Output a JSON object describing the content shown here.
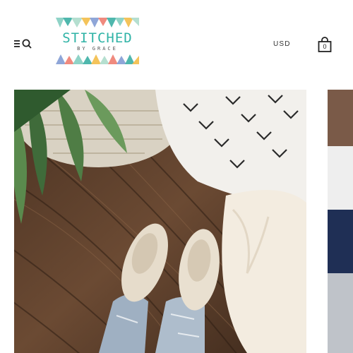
{
  "header": {
    "menu_icon": "menu-icon",
    "search_icon": "search-icon",
    "logo": {
      "title": "STITCHED",
      "subtitle": "BY GRACE"
    },
    "currency": "USD",
    "cart": {
      "icon": "shopping-bag-icon",
      "count": "0"
    }
  },
  "colors": {
    "brand_teal": "#2fb3a6",
    "triangle_colors": [
      "#8fd3c7",
      "#4fb7ad",
      "#f4c35a",
      "#f08a7e",
      "#8fa6d8",
      "#b5dfd0"
    ]
  },
  "gallery": {
    "main_image": "instagram-photo-shoes-on-wood-floor",
    "next_image": "instagram-photo-partial"
  }
}
